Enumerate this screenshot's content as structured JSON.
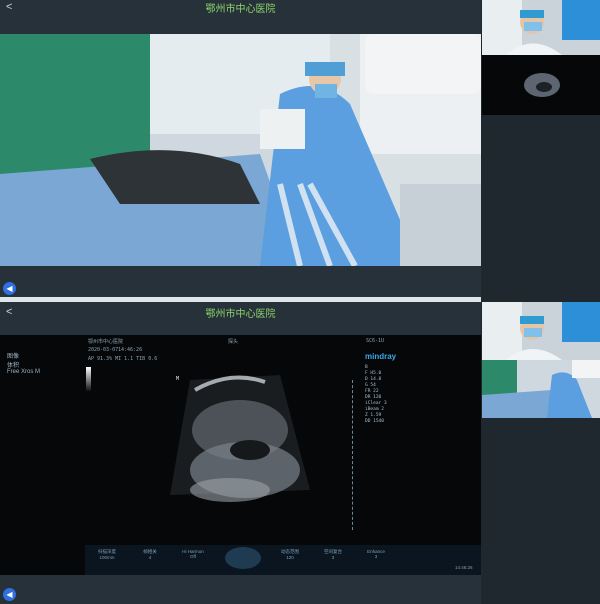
{
  "app": {
    "hospital_title": "鄂州市中心医院",
    "back_glyph": "<",
    "speaker_icon": "speaker-icon"
  },
  "ultrasound": {
    "header_left": "鄂州市中心医院",
    "header_mid": "探头",
    "header_right": "SC6-1U",
    "date": "2020-03-07",
    "time": "14:46:26",
    "ap_line": "AP 91.3% MI 1.1 TIB 0.6",
    "menu": [
      "图像",
      "体积",
      "Free Xros M"
    ],
    "brand": "mindray",
    "params": [
      "B",
      "F H5.0",
      "D 14.8",
      "G 54",
      "FR 22",
      "DR 120",
      "iClear 3",
      "iBeam 2",
      "Z 1.59",
      "DD 1540"
    ],
    "controls": [
      {
        "label": "扫描深度",
        "value": "100mm"
      },
      {
        "label": "帧相关",
        "value": "4"
      },
      {
        "label": "Hi Harmon",
        "value": "Off"
      },
      {
        "label": "动态范围",
        "value": "120"
      },
      {
        "label": "空间复合",
        "value": "3"
      },
      {
        "label": "Enhance",
        "value": "3"
      }
    ],
    "bottom_right": "14:46:26"
  }
}
